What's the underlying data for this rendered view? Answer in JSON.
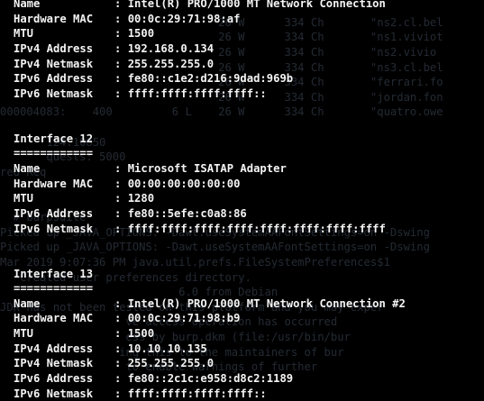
{
  "terminal": {
    "interfaces_top": [
      {
        "key": "Name",
        "value": "Intel(R) PRO/1000 MT Network Connection"
      },
      {
        "key": "Hardware MAC",
        "value": "00:0c:29:71:98:af"
      },
      {
        "key": "MTU",
        "value": "1500"
      },
      {
        "key": "IPv4 Address",
        "value": "192.168.0.134"
      },
      {
        "key": "IPv4 Netmask",
        "value": "255.255.255.0"
      },
      {
        "key": "IPv6 Address",
        "value": "fe80::c1e2:d216:9dad:969b"
      },
      {
        "key": "IPv6 Netmask",
        "value": "ffff:ffff:ffff:ffff::"
      }
    ],
    "interface12": {
      "header": "Interface 12",
      "rule": "============",
      "rows": [
        {
          "key": "Name",
          "value": "Microsoft ISATAP Adapter"
        },
        {
          "key": "Hardware MAC",
          "value": "00:00:00:00:00:00"
        },
        {
          "key": "MTU",
          "value": "1280"
        },
        {
          "key": "IPv6 Address",
          "value": "fe80::5efe:c0a8:86"
        },
        {
          "key": "IPv6 Netmask",
          "value": "ffff:ffff:ffff:ffff:ffff:ffff:ffff:ffff"
        }
      ]
    },
    "interface13": {
      "header": "Interface 13",
      "rule": "============",
      "rows": [
        {
          "key": "Name",
          "value": "Intel(R) PRO/1000 MT Network Connection #2"
        },
        {
          "key": "Hardware MAC",
          "value": "00:0c:29:71:98:b9"
        },
        {
          "key": "MTU",
          "value": "1500"
        },
        {
          "key": "IPv4 Address",
          "value": "10.10.10.135"
        },
        {
          "key": "IPv4 Netmask",
          "value": "255.255.255.0"
        },
        {
          "key": "IPv6 Address",
          "value": "fe80::2c1c:e958:d8c2:1189"
        },
        {
          "key": "IPv6 Netmask",
          "value": "ffff:ffff:ffff:ffff::"
        }
      ]
    },
    "separator": ": ",
    "background_color": "#000000",
    "text_color": "#f4f4f4",
    "ghost_color": "#242a33",
    "ghost_lines": [
      "",
      "                                 26 W      334 Ch       \"ns2.cl.bel",
      "                                 26 W      334 Ch       \"ns1.viviot",
      "                                 26 W      334 Ch       \"ns2.vivio",
      "                                 26 W      334 Ch       \"ns3.cl.bel",
      "                                 26 W      334 Ch       \"ferrari.fo",
      "                                 26 W      334 Ch       \"jordan.fon",
      "000004083:    400         6 L    26 W      334 Ch       \"quatro.owe",
      "",
      "       124.10850",
      "       quests: 5000",
      "red Req",
      "",
      "",
      "  # burpsuite",
      "Picked up _JAVA_OPTIONS: -Dawt.useSystemAAFontSettings=on -Dswing",
      "Picked up _JAVA_OPTIONS: -Dawt.useSystemAAFontSettings=on -Dswing",
      "Mar 2019 9:07:36 PM java.util.prefs.FileSystemPreferences$1",
      "   Created user preferences directory.",
      "                           6.0 from Debian",
      "JDK has not been tested on this platform and you may exper",
      "                   ve access operation has occurred",
      "                   ess by burp.dkm (file:/usr/bin/bur",
      "                  ing this to the maintainers of bur",
      "                   to enable warnings of further",
      "                                                   "
    ]
  }
}
